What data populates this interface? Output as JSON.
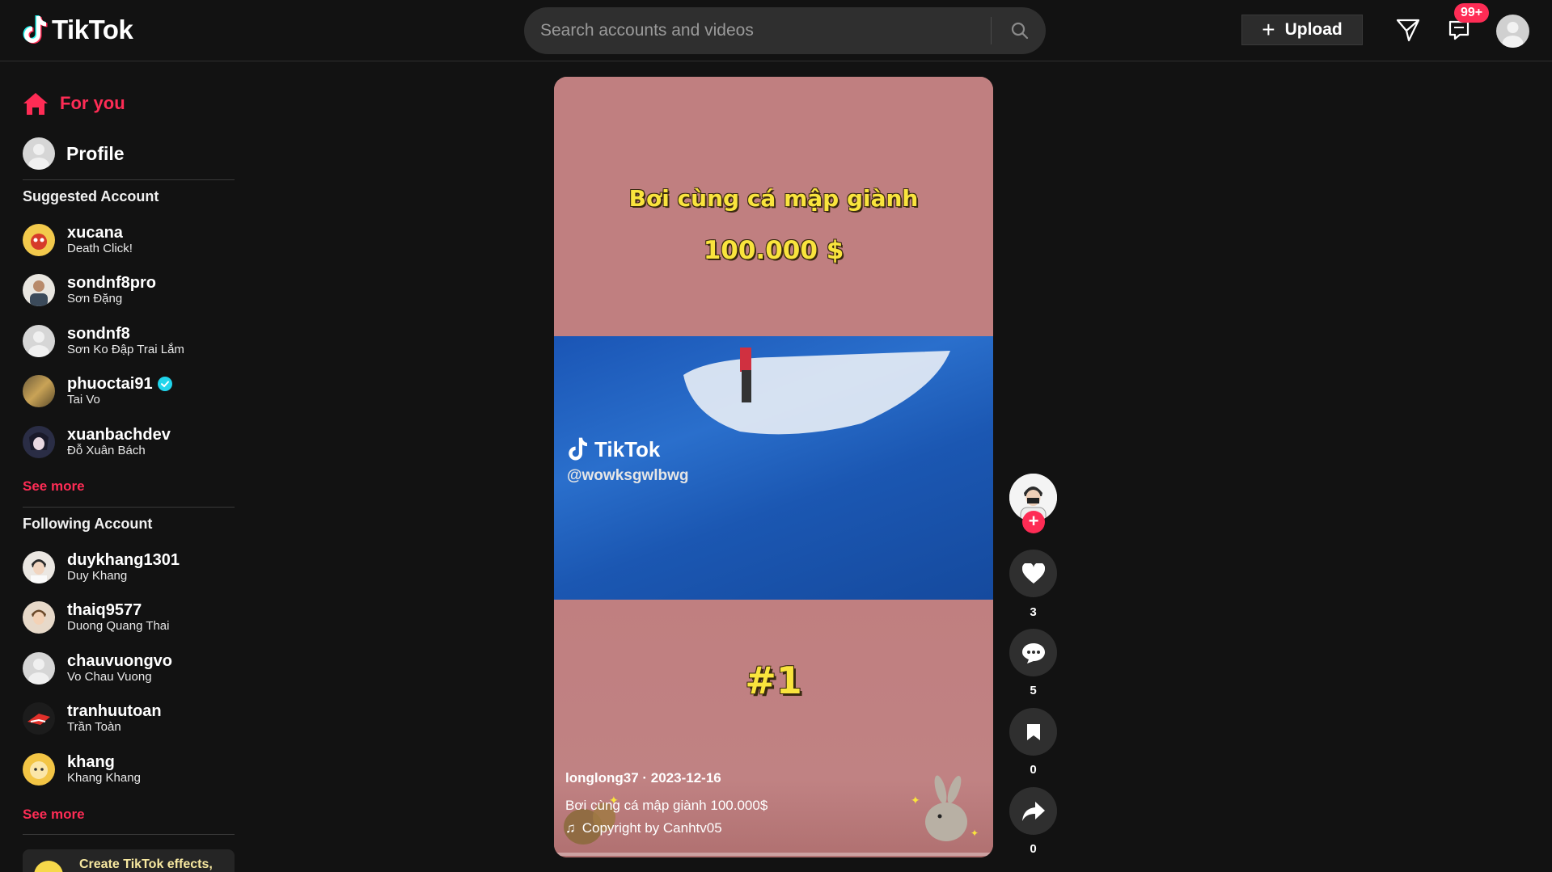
{
  "header": {
    "logo_text": "TikTok",
    "search_placeholder": "Search accounts and videos",
    "upload_label": "Upload",
    "inbox_badge": "99+"
  },
  "sidebar": {
    "nav": [
      {
        "label": "For you",
        "icon": "home-icon",
        "active": true
      },
      {
        "label": "Profile",
        "icon": "avatar"
      }
    ],
    "suggested_title": "Suggested Account",
    "suggested": [
      {
        "username": "xucana",
        "nickname": "Death Click!"
      },
      {
        "username": "sondnf8pro",
        "nickname": "Sơn Đặng"
      },
      {
        "username": "sondnf8",
        "nickname": "Sơn Ko Đập Trai Lắm"
      },
      {
        "username": "phuoctai91",
        "nickname": "Tai Vo",
        "verified": true
      },
      {
        "username": "xuanbachdev",
        "nickname": "Đỗ Xuân Bách"
      }
    ],
    "suggested_see_more": "See more",
    "following_title": "Following Account",
    "following": [
      {
        "username": "duykhang1301",
        "nickname": "Duy Khang"
      },
      {
        "username": "thaiq9577",
        "nickname": "Duong Quang Thai"
      },
      {
        "username": "chauvuongvo",
        "nickname": "Vo Chau Vuong"
      },
      {
        "username": "tranhuutoan",
        "nickname": "Trần Toàn"
      },
      {
        "username": "khang",
        "nickname": "Khang Khang"
      }
    ],
    "following_see_more": "See more",
    "effects_label": "Create TikTok effects,"
  },
  "video": {
    "overlay_title_line1": "Bơi cùng cá mập giành",
    "overlay_title_line2": "100.000 $",
    "overlay_rank": "#1",
    "watermark_logo": "TikTok",
    "watermark_handle": "@wowksgwlbwg",
    "author_date": "longlong37 · 2023-12-16",
    "description": "Bơi cùng cá mập giành 100.000$",
    "music": "Copyright by Canhtv05"
  },
  "actions": {
    "like_count": "3",
    "comment_count": "5",
    "save_count": "0",
    "share_count": "0"
  },
  "colors": {
    "accent": "#fe2c55",
    "background": "#121212",
    "overlay_text": "#f9e43d"
  }
}
